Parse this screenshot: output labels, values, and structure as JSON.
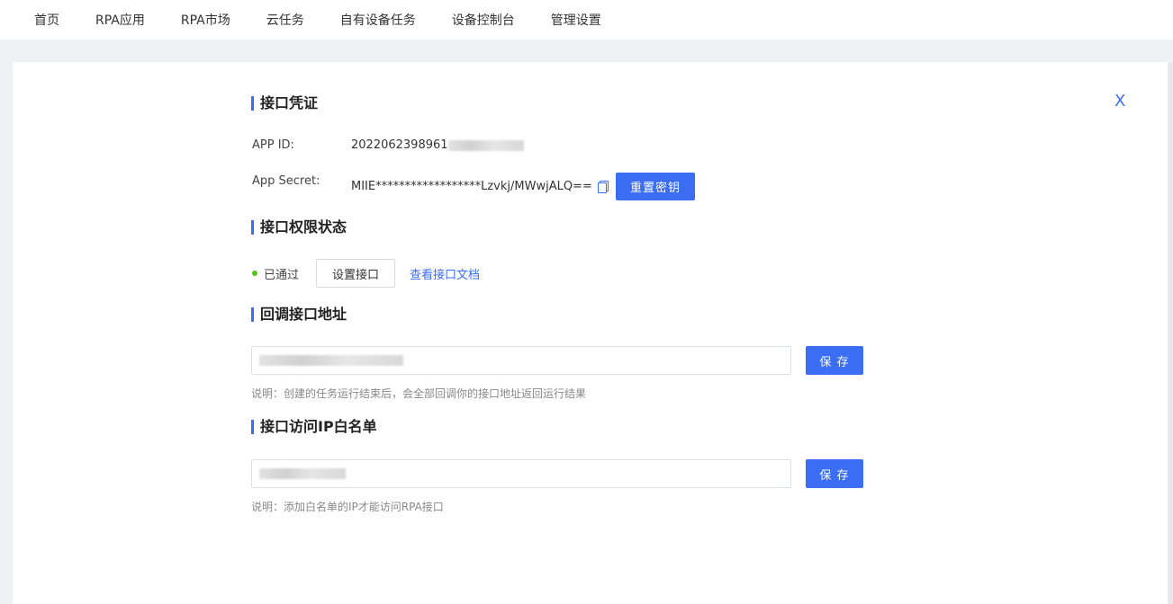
{
  "nav": {
    "items": [
      "首页",
      "RPA应用",
      "RPA市场",
      "云任务",
      "自有设备任务",
      "设备控制台",
      "管理设置"
    ]
  },
  "close": {
    "label": "X"
  },
  "credentials": {
    "title": "接口凭证",
    "app_id_label": "APP ID:",
    "app_id_value": "2022062398961",
    "app_secret_label": "App Secret:",
    "app_secret_value": "MIIE******************Lzvkj/MWwjALQ==",
    "reset_button": "重置密钥"
  },
  "permission": {
    "title": "接口权限状态",
    "status": "已通过",
    "set_button": "设置接口",
    "doc_link": "查看接口文档"
  },
  "callback": {
    "title": "回调接口地址",
    "save_button": "保 存",
    "hint": "说明：创建的任务运行结束后，会全部回调你的接口地址返回运行结果"
  },
  "whitelist": {
    "title": "接口访问IP白名单",
    "save_button": "保 存",
    "hint": "说明：添加白名单的IP才能访问RPA接口"
  },
  "colors": {
    "accent": "#3b6ef5",
    "status_ok": "#52c41a",
    "background": "#f0f1f5"
  }
}
